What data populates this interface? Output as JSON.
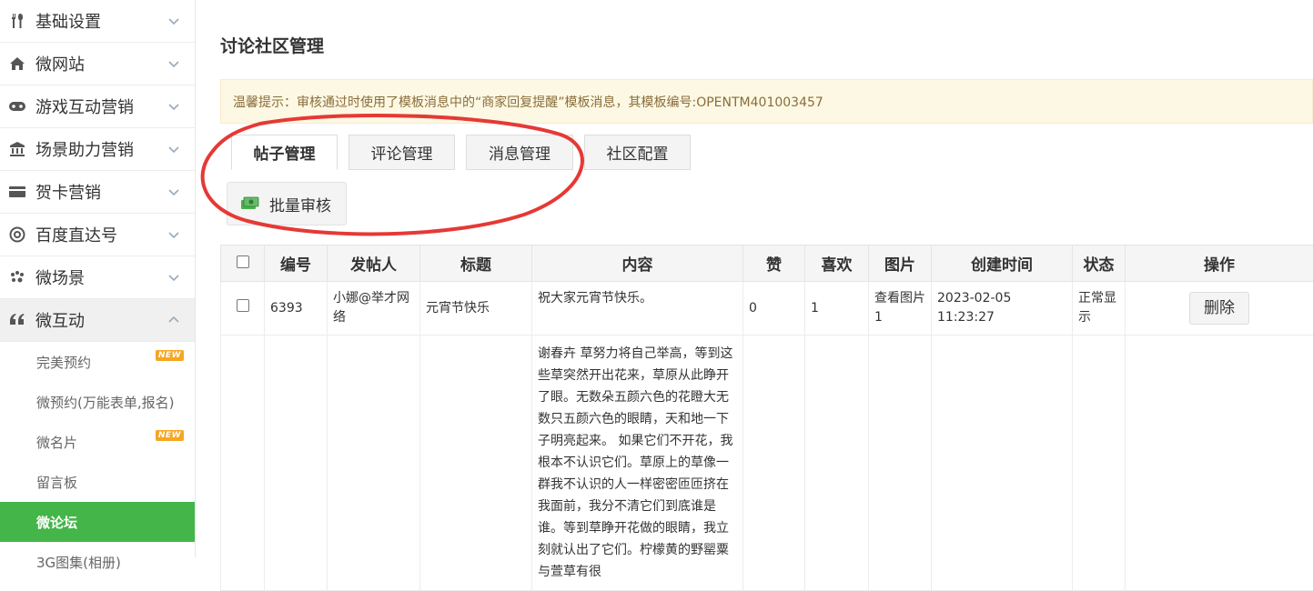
{
  "sidebar": {
    "items": [
      {
        "label": "基础设置",
        "icon": "tools-icon"
      },
      {
        "label": "微网站",
        "icon": "home-icon"
      },
      {
        "label": "游戏互动营销",
        "icon": "gamepad-icon"
      },
      {
        "label": "场景助力营销",
        "icon": "bank-icon"
      },
      {
        "label": "贺卡营销",
        "icon": "card-icon"
      },
      {
        "label": "百度直达号",
        "icon": "at-icon"
      },
      {
        "label": "微场景",
        "icon": "paw-icon"
      },
      {
        "label": "微互动",
        "icon": "quote-icon"
      }
    ],
    "sub_items": [
      {
        "label": "完美预约",
        "badge": "NEW"
      },
      {
        "label": "微预约(万能表单,报名)",
        "badge": ""
      },
      {
        "label": "微名片",
        "badge": "NEW"
      },
      {
        "label": "留言板",
        "badge": ""
      },
      {
        "label": "微论坛",
        "badge": ""
      },
      {
        "label": "3G图集(相册)",
        "badge": ""
      }
    ]
  },
  "main": {
    "title": "讨论社区管理",
    "notice": "温馨提示：审核通过时使用了模板消息中的“商家回复提醒”模板消息，其模板编号:OPENTM401003457",
    "tabs": [
      "帖子管理",
      "评论管理",
      "消息管理",
      "社区配置"
    ],
    "batch_button": "批量审核"
  },
  "table": {
    "headers": [
      "编号",
      "发帖人",
      "标题",
      "内容",
      "赞",
      "喜欢",
      "图片",
      "创建时间",
      "状态",
      "操作"
    ],
    "rows": [
      {
        "id": "6393",
        "author": "小娜@举才网络",
        "title": "元宵节快乐",
        "content": "祝大家元宵节快乐。",
        "likes": "0",
        "favorites": "1",
        "image": "查看图片1",
        "created": "2023-02-05 11:23:27",
        "status": "正常显示",
        "action": "删除"
      },
      {
        "content": "谢春卉 草努力将自己举高，等到这些草突然开出花来，草原从此睁开了眼。无数朵五颜六色的花瞪大无数只五颜六色的眼睛，天和地一下子明亮起来。 如果它们不开花，我根本不认识它们。草原上的草像一群我不认识的人一样密密匝匝挤在我面前，我分不清它们到底谁是谁。等到草睁开花做的眼睛，我立刻就认出了它们。柠檬黄的野罂粟与萱草有很"
      }
    ]
  },
  "colors": {
    "accent": "#44b549",
    "notice_bg": "#fcf8e3",
    "notice_text": "#8a6d3b",
    "annotation": "#e53935",
    "badge": "#f5a623"
  }
}
